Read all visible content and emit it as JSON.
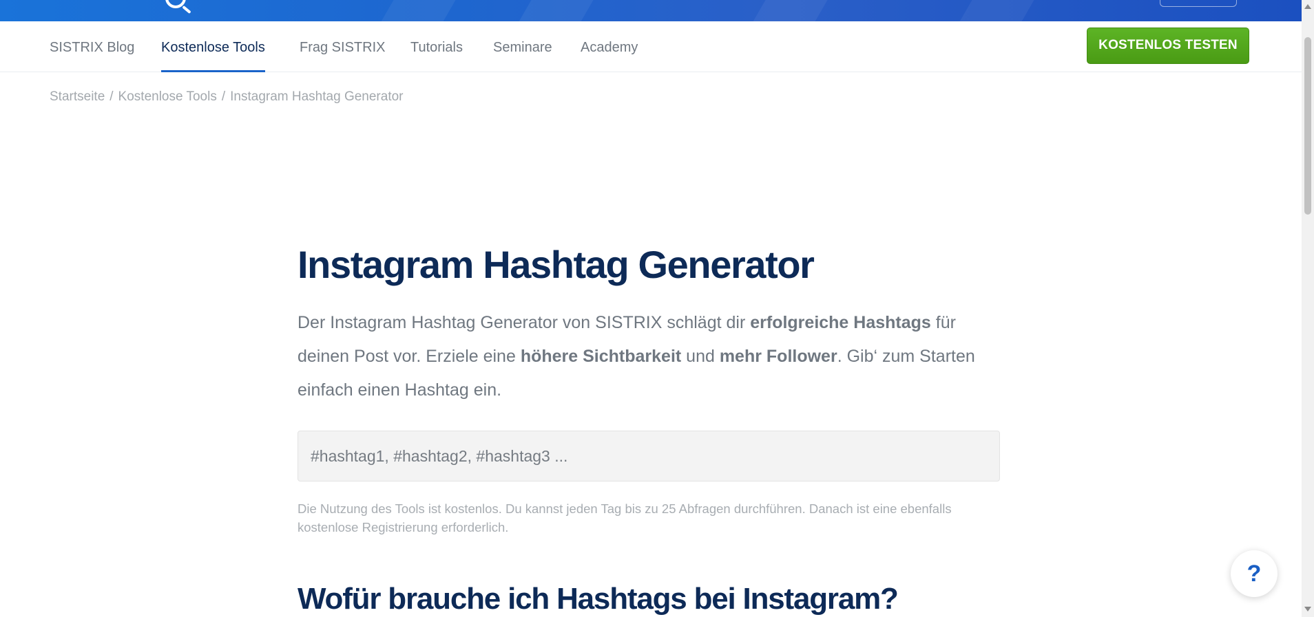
{
  "nav": {
    "items": [
      {
        "label": "SISTRIX Blog",
        "active": false
      },
      {
        "label": "Kostenlose Tools",
        "active": true
      },
      {
        "label": "Frag SISTRIX",
        "active": false
      },
      {
        "label": "Tutorials",
        "active": false
      },
      {
        "label": "Seminare",
        "active": false
      },
      {
        "label": "Academy",
        "active": false
      }
    ],
    "cta_label": "KOSTENLOS TESTEN"
  },
  "breadcrumb": {
    "items": [
      "Startseite",
      "Kostenlose Tools",
      "Instagram Hashtag Generator"
    ],
    "separator": "/"
  },
  "main": {
    "title": "Instagram Hashtag Generator",
    "intro": {
      "p1": "Der Instagram Hashtag Generator von SISTRIX schlägt dir ",
      "b1": "erfolgreiche Hashtags",
      "p2": " für deinen Post vor. Erziele eine ",
      "b2": "höhere Sichtbarkeit",
      "p3": " und ",
      "b3": "mehr Follower",
      "p4": ". Gib‘ zum Starten einfach einen Hashtag ein."
    },
    "input": {
      "placeholder": "#hashtag1, #hashtag2, #hashtag3 ...",
      "value": ""
    },
    "note": "Die Nutzung des Tools ist kostenlos. Du kannst jeden Tag bis zu 25 Abfragen durchführen. Danach ist eine ebenfalls kostenlose Registrierung erforderlich.",
    "section_heading": "Wofür brauche ich Hashtags bei Instagram?"
  },
  "help": {
    "label": "?"
  },
  "colors": {
    "brand_blue": "#1a63c9",
    "heading_navy": "#0d2a57",
    "cta_green": "#4a9b14"
  }
}
